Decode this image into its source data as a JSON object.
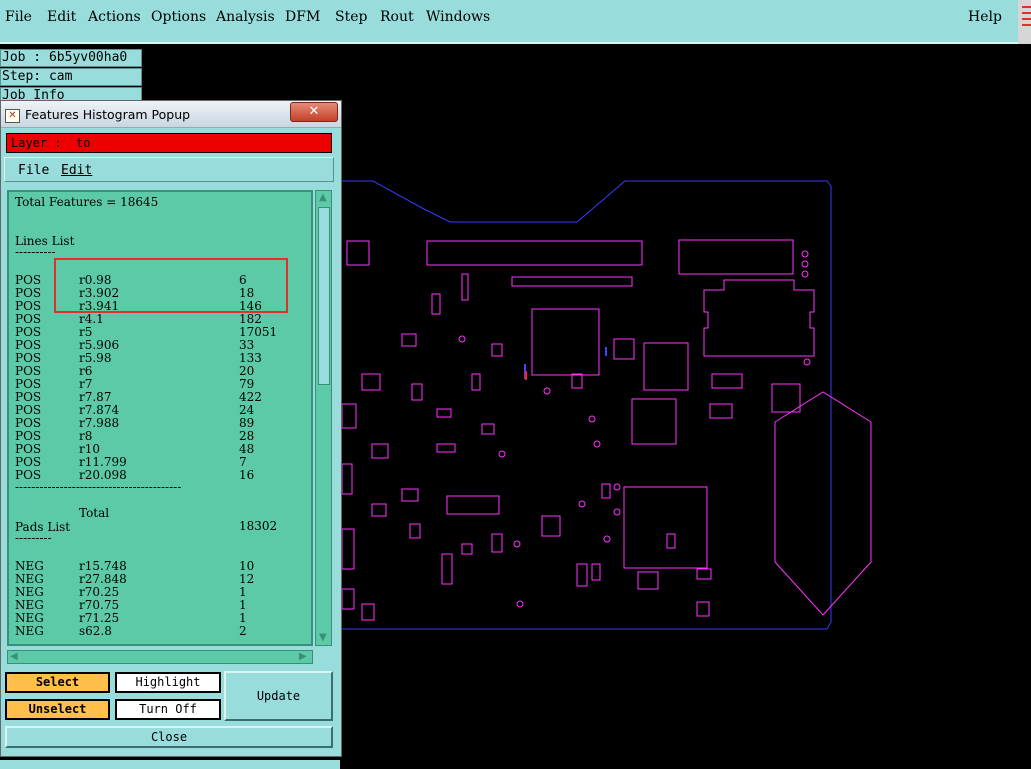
{
  "menu": {
    "items": [
      "File",
      "Edit",
      "Actions",
      "Options",
      "Analysis",
      "DFM",
      "Step",
      "Rout",
      "Windows"
    ],
    "help": "Help"
  },
  "job_info": {
    "job": "Job : 6b5yv00ha0",
    "step": "Step: cam",
    "partial": "Job Info"
  },
  "popup": {
    "title": "Features Histogram Popup",
    "close_glyph": "✕",
    "layer_label": "Layer :  to",
    "menu": [
      "File",
      "Edit"
    ],
    "total_features": "Total Features = 18645",
    "lines_header": "Lines List",
    "lines_rule": "----------",
    "lines": [
      {
        "polarity": "POS",
        "symbol": "r0.98",
        "count": "6"
      },
      {
        "polarity": "POS",
        "symbol": "r3.902",
        "count": "18"
      },
      {
        "polarity": "POS",
        "symbol": "r3.941",
        "count": "146"
      },
      {
        "polarity": "POS",
        "symbol": "r4.1",
        "count": "182"
      },
      {
        "polarity": "POS",
        "symbol": "r5",
        "count": "17051"
      },
      {
        "polarity": "POS",
        "symbol": "r5.906",
        "count": "33"
      },
      {
        "polarity": "POS",
        "symbol": "r5.98",
        "count": "133"
      },
      {
        "polarity": "POS",
        "symbol": "r6",
        "count": "20"
      },
      {
        "polarity": "POS",
        "symbol": "r7",
        "count": "79"
      },
      {
        "polarity": "POS",
        "symbol": "r7.87",
        "count": "422"
      },
      {
        "polarity": "POS",
        "symbol": "r7.874",
        "count": "24"
      },
      {
        "polarity": "POS",
        "symbol": "r7.988",
        "count": "89"
      },
      {
        "polarity": "POS",
        "symbol": "r8",
        "count": "28"
      },
      {
        "polarity": "POS",
        "symbol": "r10",
        "count": "48"
      },
      {
        "polarity": "POS",
        "symbol": "r11.799",
        "count": "7"
      },
      {
        "polarity": "POS",
        "symbol": "r20.098",
        "count": "16"
      }
    ],
    "divider": "-----------------------------------------",
    "total_label": "Total",
    "total_value": "18302",
    "pads_header": "Pads List",
    "pads_rule": "---------",
    "pads": [
      {
        "polarity": "NEG",
        "symbol": "r15.748",
        "count": "10"
      },
      {
        "polarity": "NEG",
        "symbol": "r27.848",
        "count": "12"
      },
      {
        "polarity": "NEG",
        "symbol": "r70.25",
        "count": "1"
      },
      {
        "polarity": "NEG",
        "symbol": "r70.75",
        "count": "1"
      },
      {
        "polarity": "NEG",
        "symbol": "r71.25",
        "count": "1"
      },
      {
        "polarity": "NEG",
        "symbol": "s62.8",
        "count": "2"
      }
    ],
    "buttons": {
      "select": "Select",
      "unselect": "Unselect",
      "highlight": "Highlight",
      "turn_off": "Turn Off",
      "update": "Update",
      "close": "Close"
    }
  },
  "colors": {
    "panel": "#99dcdc",
    "list_bg": "#5ccaa6",
    "board_outline": "#3a3aff",
    "features": "#ff33ff",
    "layer_bar": "#ee0000",
    "highlight_box": "#e0302a"
  }
}
